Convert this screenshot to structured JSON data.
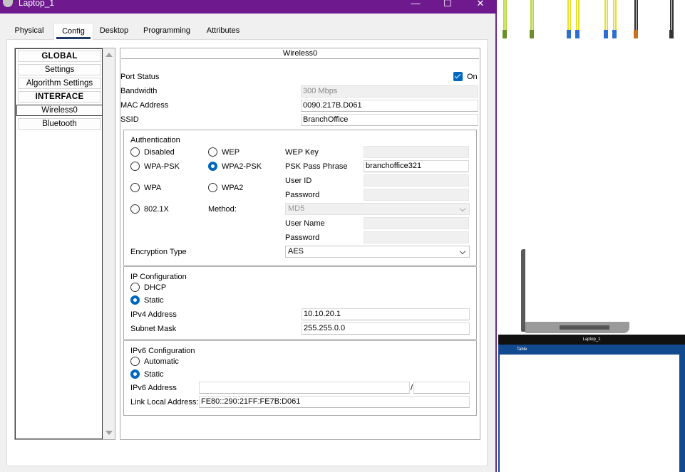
{
  "window": {
    "title": "Laptop_1",
    "minimize_glyph": "—",
    "maximize_glyph": "☐",
    "close_glyph": "✕"
  },
  "tabs": [
    "Physical",
    "Config",
    "Desktop",
    "Programming",
    "Attributes"
  ],
  "active_tab": "Config",
  "left_list": {
    "items": [
      "GLOBAL",
      "Settings",
      "Algorithm Settings",
      "INTERFACE",
      "Wireless0",
      "Bluetooth"
    ],
    "selected": "Wireless0"
  },
  "panel": {
    "title": "Wireless0",
    "port_status": {
      "label": "Port Status",
      "checkbox_label": "On",
      "checked": true
    },
    "bandwidth": {
      "label": "Bandwidth",
      "value": "300 Mbps"
    },
    "mac": {
      "label": "MAC Address",
      "value": "0090.217B.D061"
    },
    "ssid": {
      "label": "SSID",
      "value": "BranchOffice"
    },
    "auth": {
      "title": "Authentication",
      "options": {
        "disabled": "Disabled",
        "wep": "WEP",
        "wpa_psk": "WPA-PSK",
        "wpa2_psk": "WPA2-PSK",
        "wpa": "WPA",
        "wpa2": "WPA2",
        "dot1x": "802.1X"
      },
      "selected": "WPA2-PSK",
      "wep_key_label": "WEP Key",
      "psk_label": "PSK Pass Phrase",
      "psk_value": "branchoffice321",
      "user_id_label": "User ID",
      "password_label": "Password",
      "method_label": "Method:",
      "method_value": "MD5",
      "user_name_label": "User Name",
      "password2_label": "Password",
      "encryption_label": "Encryption Type",
      "encryption_value": "AES"
    },
    "ipconf": {
      "title": "IP Configuration",
      "dhcp_label": "DHCP",
      "static_label": "Static",
      "selected": "Static",
      "ipv4_label": "IPv4 Address",
      "ipv4_value": "10.10.20.1",
      "mask_label": "Subnet Mask",
      "mask_value": "255.255.0.0"
    },
    "ipv6conf": {
      "title": "IPv6 Configuration",
      "auto_label": "Automatic",
      "static_label": "Static",
      "selected": "Static",
      "ipv6_label": "IPv6 Address",
      "ipv6_value": "",
      "prefix_sep": "/",
      "prefix_value": "",
      "lla_label": "Link Local Address:",
      "lla_value": "FE80::290:21FF:FE7B:D061"
    }
  },
  "workspace": {
    "desk_label": "Laptop_1",
    "table_label": "Table"
  }
}
